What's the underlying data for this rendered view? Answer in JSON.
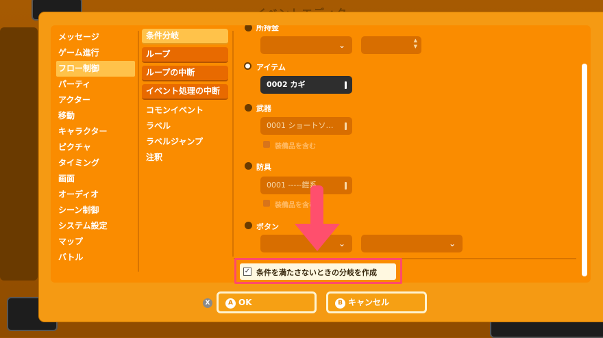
{
  "window": {
    "title": "イベントエディタ"
  },
  "categories": [
    {
      "label": "メッセージ",
      "selected": false
    },
    {
      "label": "ゲーム進行",
      "selected": false
    },
    {
      "label": "フロー制御",
      "selected": true
    },
    {
      "label": "パーティ",
      "selected": false
    },
    {
      "label": "アクター",
      "selected": false
    },
    {
      "label": "移動",
      "selected": false
    },
    {
      "label": "キャラクター",
      "selected": false
    },
    {
      "label": "ピクチャ",
      "selected": false
    },
    {
      "label": "タイミング",
      "selected": false
    },
    {
      "label": "画面",
      "selected": false
    },
    {
      "label": "オーディオ",
      "selected": false
    },
    {
      "label": "シーン制御",
      "selected": false
    },
    {
      "label": "システム設定",
      "selected": false
    },
    {
      "label": "マップ",
      "selected": false
    },
    {
      "label": "バトル",
      "selected": false
    }
  ],
  "commands": [
    {
      "label": "条件分岐",
      "selected": true
    },
    {
      "label": "ループ",
      "selected": false
    },
    {
      "label": "ループの中断",
      "selected": false
    },
    {
      "label": "イベント処理の中断",
      "selected": false
    }
  ],
  "commands_plain": [
    "コモンイベント",
    "ラベル",
    "ラベルジャンプ",
    "注釈"
  ],
  "options": {
    "gold": {
      "label": "所持金"
    },
    "item": {
      "label": "アイテム",
      "value": "0002 カギ"
    },
    "weapon": {
      "label": "武器",
      "value": "0001 ショートソ…",
      "include_equipment": "装備品を含む"
    },
    "armor": {
      "label": "防具",
      "value": "0001 -----鎧系",
      "include_equipment": "装備品を含む"
    },
    "button": {
      "label": "ボタン"
    }
  },
  "else_branch": {
    "label": "条件を満たさないときの分岐を作成",
    "checked": true,
    "check_glyph": "✓"
  },
  "actions": {
    "x_hint": "X",
    "ok": {
      "badge": "A",
      "label": "OK"
    },
    "cancel": {
      "badge": "B",
      "label": "キャンセル"
    }
  },
  "icons": {
    "chevron": "⌄",
    "spin_up": "▲",
    "spin_down": "▼"
  },
  "colors": {
    "accent": "#f59a13",
    "highlight": "#ff4f6d",
    "panel": "#fa8c00"
  }
}
